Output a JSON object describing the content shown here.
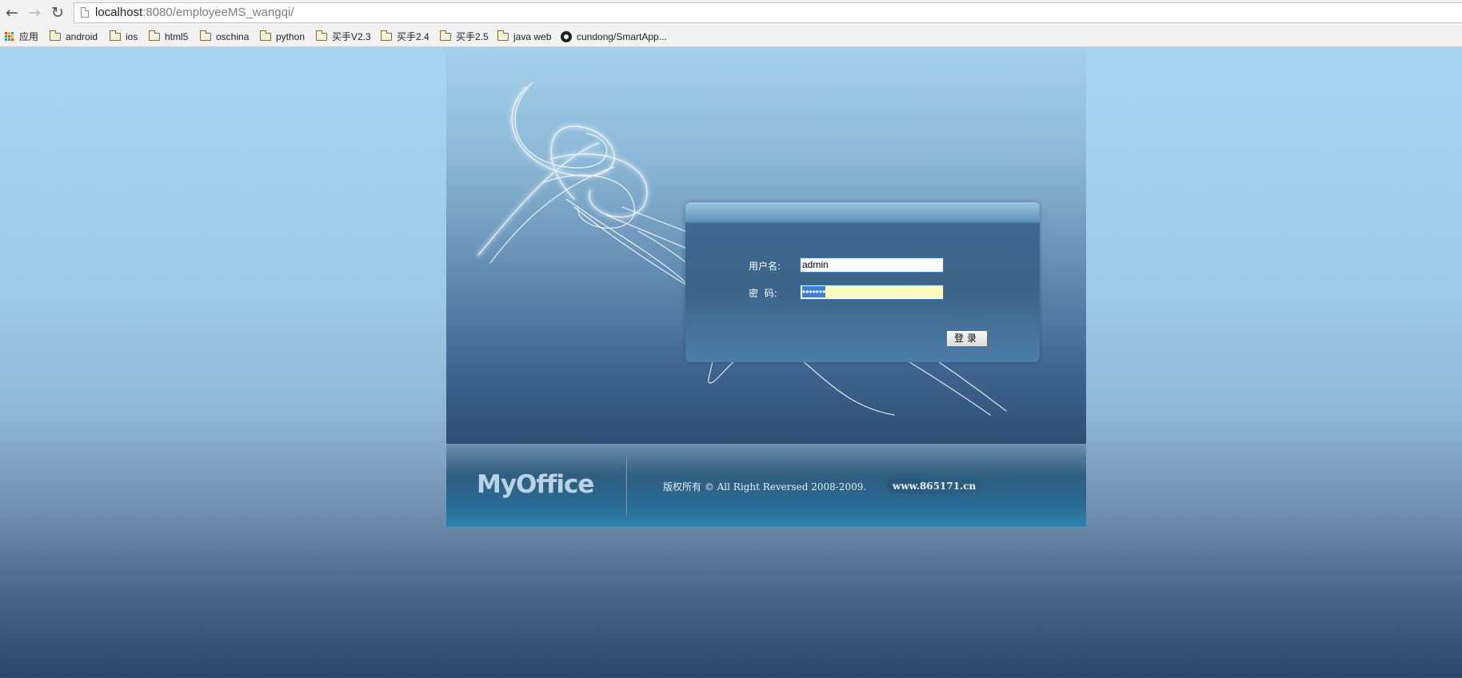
{
  "browser": {
    "url_host": "localhost",
    "url_path": ":8080/employeeMS_wangqi/",
    "bookmarks": [
      {
        "label": "应用",
        "icon": "apps-icon"
      },
      {
        "label": "android",
        "icon": "folder-icon"
      },
      {
        "label": "ios",
        "icon": "folder-icon"
      },
      {
        "label": "html5",
        "icon": "folder-icon"
      },
      {
        "label": "oschina",
        "icon": "folder-icon"
      },
      {
        "label": "python",
        "icon": "folder-icon"
      },
      {
        "label": "买手V2.3",
        "icon": "folder-icon"
      },
      {
        "label": "买手2.4",
        "icon": "folder-icon"
      },
      {
        "label": "买手2.5",
        "icon": "folder-icon"
      },
      {
        "label": "java web",
        "icon": "folder-icon"
      },
      {
        "label": "cundong/SmartApp...",
        "icon": "github-icon"
      }
    ]
  },
  "login": {
    "username_label": "用户名:",
    "username_value": "admin",
    "password_label": "密  码:",
    "password_masked": "•••••••",
    "submit_label": "登录"
  },
  "footer": {
    "logo": "MyOffice",
    "copyright": "版权所有 © All Right Reversed 2008-2009.",
    "site": "www.865171.cn"
  },
  "colors": {
    "background_top": "#a5d5f2",
    "background_bottom": "#2d4569",
    "panel": "#3b6489",
    "password_fill": "#fdfcbf",
    "selection": "#3a7fe0"
  }
}
